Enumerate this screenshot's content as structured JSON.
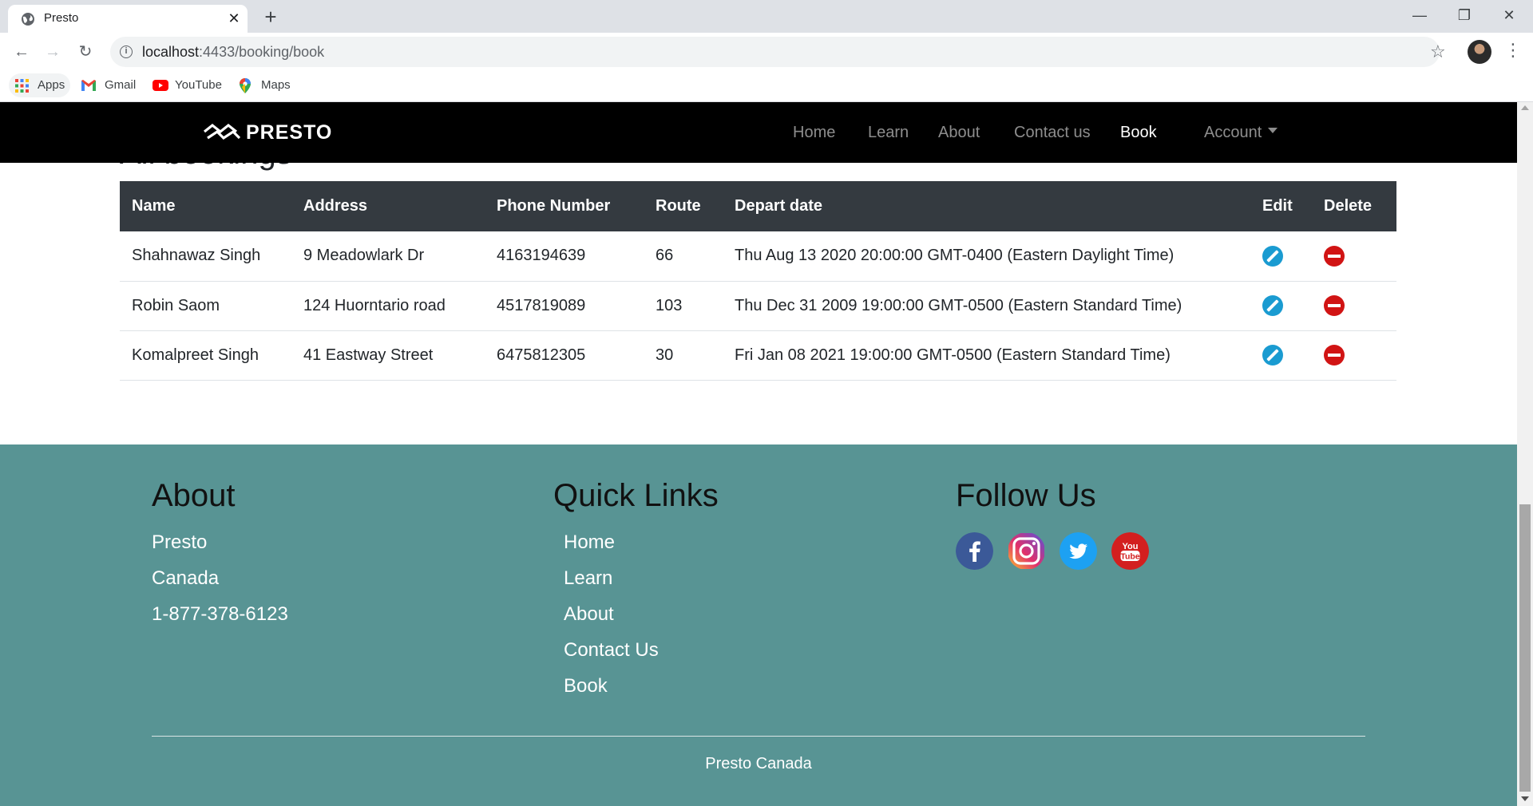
{
  "browser": {
    "tab_title": "Presto",
    "tab_close": "✕",
    "new_tab": "+",
    "url_host": "localhost",
    "url_rest": ":4433/booking/book",
    "bookmarks": [
      {
        "label": "Apps",
        "icon": "apps-grid-icon"
      },
      {
        "label": "Gmail",
        "icon": "gmail-icon"
      },
      {
        "label": "YouTube",
        "icon": "youtube-icon"
      },
      {
        "label": "Maps",
        "icon": "maps-icon"
      }
    ]
  },
  "site": {
    "brand": "PRESTO",
    "nav": {
      "home": "Home",
      "learn": "Learn",
      "about": "About",
      "contact": "Contact us",
      "book": "Book",
      "account": "Account"
    },
    "active_nav": "Book",
    "page_title": "All bookings"
  },
  "table": {
    "headers": {
      "name": "Name",
      "address": "Address",
      "phone": "Phone Number",
      "route": "Route",
      "depart": "Depart date",
      "edit": "Edit",
      "delete": "Delete"
    },
    "rows": [
      {
        "name": "Shahnawaz Singh",
        "address": "9 Meadowlark Dr",
        "phone": "4163194639",
        "route": "66",
        "depart": "Thu Aug 13 2020 20:00:00 GMT-0400 (Eastern Daylight Time)"
      },
      {
        "name": "Robin Saom",
        "address": "124 Huorntario road",
        "phone": "4517819089",
        "route": "103",
        "depart": "Thu Dec 31 2009 19:00:00 GMT-0500 (Eastern Standard Time)"
      },
      {
        "name": "Komalpreet Singh",
        "address": "41 Eastway Street",
        "phone": "6475812305",
        "route": "30",
        "depart": "Fri Jan 08 2021 19:00:00 GMT-0500 (Eastern Standard Time)"
      }
    ]
  },
  "footer": {
    "about": {
      "heading": "About",
      "lines": [
        "Presto",
        "Canada",
        "1-877-378-6123"
      ]
    },
    "quick_links": {
      "heading": "Quick Links",
      "links": [
        "Home",
        "Learn",
        "About",
        "Contact Us",
        "Book"
      ]
    },
    "follow": {
      "heading": "Follow Us",
      "icons": [
        "facebook-icon",
        "instagram-icon",
        "twitter-icon",
        "youtube-icon"
      ]
    },
    "copyright": "Presto Canada"
  },
  "colors": {
    "navbar": "#000000",
    "table_header": "#343a40",
    "footer_bg": "#589494",
    "edit_icon": "#1a9bd1",
    "delete_icon": "#d11414"
  }
}
